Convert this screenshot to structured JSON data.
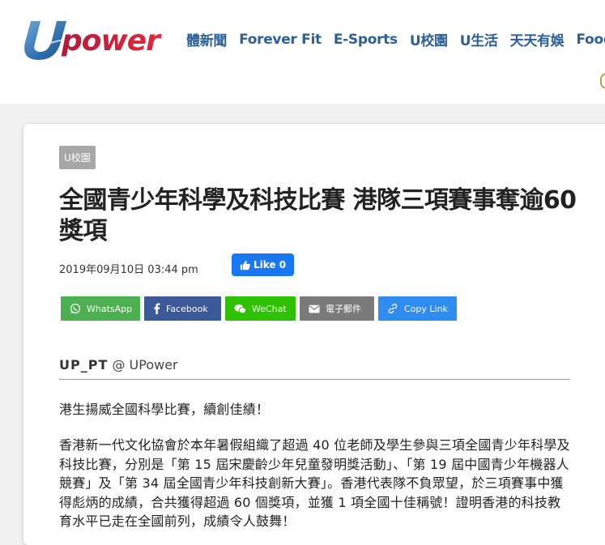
{
  "brand": {
    "logo_text": "Upower",
    "colors": {
      "u_blue": "#2f6fae",
      "power_red": "#d6213a",
      "nav_blue": "#2d5f98"
    }
  },
  "nav": {
    "items": [
      {
        "label": "體新聞"
      },
      {
        "label": "Forever Fit"
      },
      {
        "label": "E-Sports"
      },
      {
        "label": "U校園"
      },
      {
        "label": "U生活"
      },
      {
        "label": "天天有娛"
      },
      {
        "label": "Fooday"
      }
    ]
  },
  "article": {
    "category_tag": "U校園",
    "title": "全國青少年科學及科技比賽 港隊三項賽事奪逾60獎項",
    "date": "2019年09月10日 03:44 pm",
    "like_button": {
      "label": "Like 0",
      "icon": "thumbs-up-icon",
      "color": "#1877f2"
    },
    "share_buttons": [
      {
        "label": "WhatsApp",
        "icon": "whatsapp-icon",
        "color": "#4caf50"
      },
      {
        "label": "Facebook",
        "icon": "facebook-icon",
        "color": "#3b5998"
      },
      {
        "label": "WeChat",
        "icon": "wechat-icon",
        "color": "#2dc100"
      },
      {
        "label": "電子郵件",
        "icon": "mail-icon",
        "color": "#7a7a7a"
      },
      {
        "label": "Copy Link",
        "icon": "link-icon",
        "color": "#2f8cf0"
      }
    ],
    "author": {
      "name": "UP_PT",
      "at": "@ UPower"
    },
    "body": [
      "港生揚威全國科學比賽，續創佳績！",
      "香港新一代文化協會於本年暑假組織了超過 40 位老師及學生參與三項全國青少年科學及科技比賽，分別是「第 15 屆宋慶齡少年兒童發明獎活動」、「第 19 屆中國青少年機器人競賽」及「第 34 屆全國青少年科技創新大賽」。香港代表隊不負眾望，於三項賽事中獲得彪炳的成績，合共獲得超過 60 個獎項，並獲 1 項全國十佳稱號！證明香港的科技教育水平已走在全國前列，成績令人鼓舞！"
    ]
  }
}
